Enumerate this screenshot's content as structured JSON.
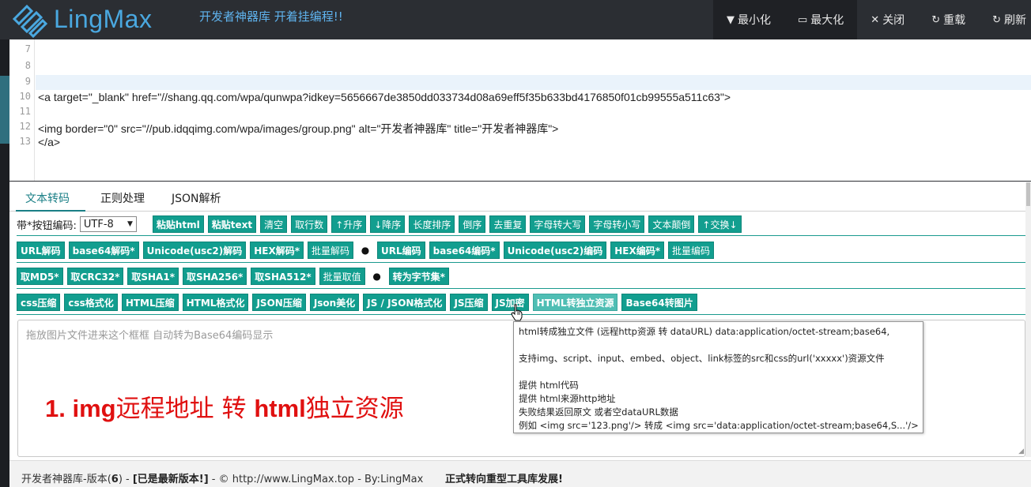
{
  "app": {
    "name": "LingMax",
    "slogan": "开发者神器库 开着挂编程!!",
    "brand_color": "#4aa8e0",
    "accent_color": "#129e8f"
  },
  "window_controls": [
    {
      "icon": "caret-down-icon",
      "glyph": "▼",
      "label": "最小化"
    },
    {
      "icon": "window-icon",
      "glyph": "▭",
      "label": "最大化"
    },
    {
      "icon": "close-icon",
      "glyph": "✕",
      "label": "关闭"
    },
    {
      "icon": "reload-icon",
      "glyph": "↻",
      "label": "重载"
    },
    {
      "icon": "refresh-icon",
      "glyph": "↻",
      "label": "刷新"
    }
  ],
  "editor": {
    "lines": [
      {
        "no": "7",
        "text": ""
      },
      {
        "no": "8",
        "text": ""
      },
      {
        "no": "9",
        "text": ""
      },
      {
        "no": "10",
        "text": "<a target=\"_blank\" href=\"//shang.qq.com/wpa/qunwpa?idkey=5656667de3850dd033734d08a69eff5f35b633bd4176850f01cb99555a511c63\">"
      },
      {
        "no": "11",
        "text": ""
      },
      {
        "no": "12",
        "text": "<img border=\"0\" src=\"//pub.idqqimg.com/wpa/images/group.png\" alt=\"开发者神器库\" title=\"开发者神器库\">"
      },
      {
        "no": "13",
        "text": "</a>"
      }
    ]
  },
  "tabs": [
    "文本转码",
    "正则处理",
    "JSON解析"
  ],
  "row1": {
    "encoding_label": "带*按钮编码:",
    "encoding_value": "UTF-8",
    "buttons": [
      "粘贴html",
      "粘贴text",
      "清空",
      "取行数",
      "↑升序",
      "↓降序",
      "长度排序",
      "倒序",
      "去重复",
      "字母转大写",
      "字母转小写",
      "文本颠倒",
      "↑交换↓"
    ]
  },
  "row2": {
    "left": [
      "URL解码",
      "base64解码*",
      "Unicode(usc2)解码",
      "HEX解码*",
      "批量解码"
    ],
    "separator": "●",
    "right": [
      "URL编码",
      "base64编码*",
      "Unicode(usc2)编码",
      "HEX编码*",
      "批量编码"
    ]
  },
  "row3": {
    "left": [
      "取MD5*",
      "取CRC32*",
      "取SHA1*",
      "取SHA256*",
      "取SHA512*",
      "批量取值"
    ],
    "separator": "●",
    "right": [
      "转为字节集*"
    ]
  },
  "row4": {
    "buttons": [
      "css压缩",
      "css格式化",
      "HTML压缩",
      "HTML格式化",
      "JSON压缩",
      "Json美化",
      "JS / JSON格式化",
      "JS压缩",
      "JS加密",
      "HTML转独立资源",
      "Base64转图片"
    ]
  },
  "droparea": {
    "placeholder": "拖放图片文件进来这个框框 自动转为Base64编码显示",
    "note_prefix": "1. img",
    "note_mid": "远程地址 转 ",
    "note_html": "html",
    "note_suffix": "独立资源"
  },
  "tooltip": {
    "lines": [
      "html转成独立文件 (远程http资源  转 dataURL) data:application/octet-stream;base64,",
      "",
      "支持img、script、input、embed、object、link标签的src和css的url('xxxxx')资源文件",
      "",
      "提供 html代码",
      "提供 html来源http地址",
      "失败结果返回原文  或者空dataURL数据",
      "例如  <img src='123.png'/> 转成 <img src='data:application/octet-stream;base64,S...'/>"
    ]
  },
  "footer": {
    "prefix": "开发者神器库-版本(",
    "version": "6",
    "mid": ") - ",
    "latest": "[已是最新版本!]",
    "suffix": " - © http://www.LingMax.top - By:LingMax",
    "news": "正式转向重型工具库发展!"
  }
}
